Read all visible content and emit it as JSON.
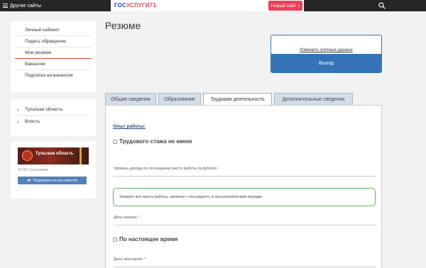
{
  "topbar": {
    "other_sites": "Другие сайты",
    "gosuslugi_logo_blue": "ГОС",
    "gosuslugi_logo_red": "УСЛУГИ71",
    "new_site_label": "Новый сайт"
  },
  "sidebar": {
    "menu": [
      {
        "label": "Личный кабинет"
      },
      {
        "label": "Подать обращение"
      },
      {
        "label": "Мое резюме"
      },
      {
        "label": "Вакансии"
      },
      {
        "label": "Подписка на вакансии"
      }
    ],
    "links": [
      {
        "label": "Тульская область"
      },
      {
        "label": "Власть"
      }
    ],
    "vk": {
      "group_name": "Тульская область",
      "members": "19 037 участников",
      "subscribe_label": "Подписаться на новости"
    }
  },
  "page": {
    "title": "Резюме"
  },
  "account": {
    "change_label": "Изменить учетные данные",
    "logout_label": "Выход"
  },
  "tabs": [
    {
      "label": "Общие сведения"
    },
    {
      "label": "Образование"
    },
    {
      "label": "Трудовая деятельность"
    },
    {
      "label": "Дополнительные сведения"
    }
  ],
  "form": {
    "section_title": "Опыт работы:",
    "no_experience_label": "Трудового стажа не имею",
    "income_label": "Уровень дохода по последнему месту работы (в рублях):",
    "hint_text": "Укажите все места работы, начиная с последнего, в хронологическом порядке.",
    "start_date_label": "Дата начала:",
    "current_label": "По настоящее время",
    "end_date_label": "Дата окончания:",
    "required_mark": "*"
  },
  "colors": {
    "accent_blue": "#3474b6",
    "active_underline": "#e0452e",
    "hint_border": "#5cb85c",
    "vk_blue": "#5181b8"
  }
}
